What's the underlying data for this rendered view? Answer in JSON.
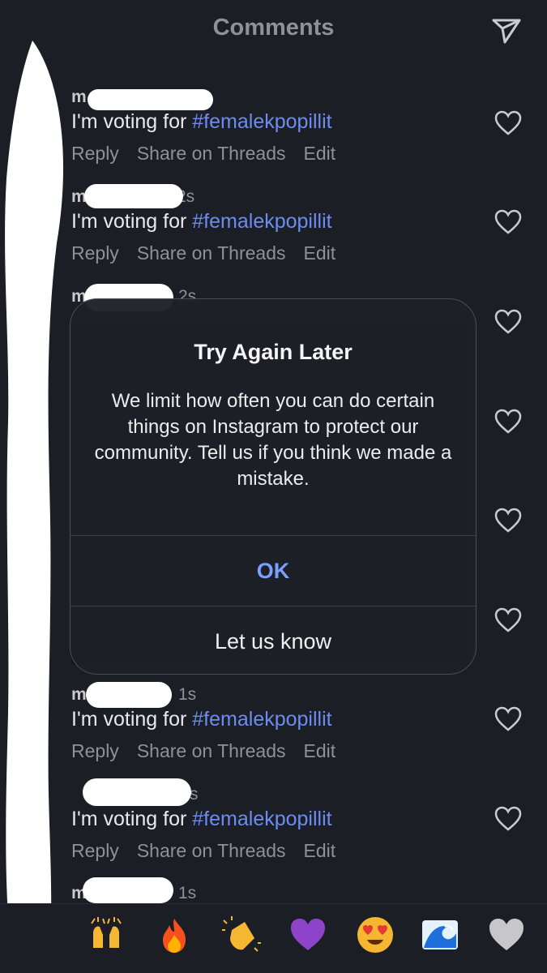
{
  "header": {
    "title": "Comments"
  },
  "comments": [
    {
      "user": "m",
      "time": "",
      "text": "I'm voting for ",
      "hashtag": "#femalekpopillit"
    },
    {
      "user": "m",
      "time": "2s",
      "text": "I'm voting for ",
      "hashtag": "#femalekpopillit"
    },
    {
      "user": "m",
      "time": "2s"
    },
    {
      "user": "m",
      "time": "1s",
      "text": "I'm voting for ",
      "hashtag": "#femalekpopillit"
    },
    {
      "user": "",
      "time": "s",
      "text": "I'm voting for ",
      "hashtag": "#femalekpopillit"
    },
    {
      "user": "m",
      "time": "1s"
    }
  ],
  "actions": {
    "reply": "Reply",
    "share": "Share on Threads",
    "edit": "Edit"
  },
  "dialog": {
    "title": "Try Again Later",
    "body": "We limit how often you can do certain things on Instagram to protect our community. Tell us if you think we made a mistake.",
    "ok_label": "OK",
    "secondary_label": "Let us know"
  },
  "emoji_bar": [
    "raising-hands",
    "fire",
    "clapping-hands",
    "purple-heart",
    "heart-eyes",
    "wave",
    "white-heart"
  ],
  "colors": {
    "accent": "#7aa0ff",
    "hashtag": "#6d8cf0",
    "background": "#1b1e25"
  }
}
